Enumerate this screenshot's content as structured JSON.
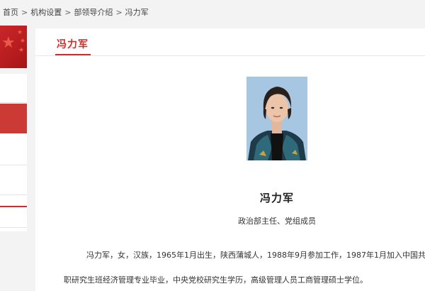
{
  "breadcrumb": {
    "items": [
      "首页",
      "机构设置",
      "部领导介绍",
      "冯力军"
    ],
    "separator": ">"
  },
  "colors": {
    "accent": "#c9302c",
    "sidebar_active": "#cc3a35",
    "banner": "#c8272a",
    "page_bg": "#f3f3f3"
  },
  "main": {
    "title": "冯力军",
    "portrait_icon": "person-photo",
    "person": {
      "name": "冯力军",
      "position": "政治部主任、党组成员"
    },
    "bio": {
      "line1": "冯力军，女，汉族，1965年1月出生，陕西蒲城人，1988年9月参加工作，1987年1月加入中国共",
      "line2": "职研究生班经济管理专业毕业，中央党校研究生学历，高级管理人员工商管理硕士学位。"
    }
  }
}
